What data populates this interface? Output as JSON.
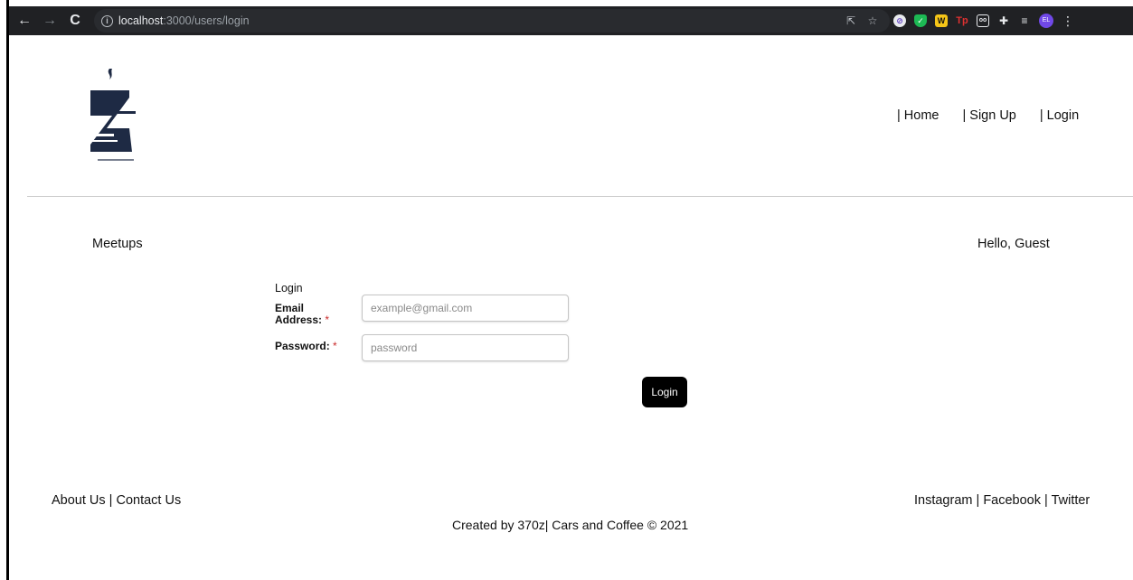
{
  "browser": {
    "url_host": "localhost",
    "url_path": ":3000/users/login",
    "avatar_initials": "EL",
    "icons": [
      "back-icon",
      "forward-icon",
      "reload-icon",
      "info-icon",
      "share-icon",
      "star-icon",
      "extension-icons",
      "puzzle-icon",
      "media-queue-icon",
      "menu-dots-icon"
    ]
  },
  "header": {
    "nav": {
      "home": "| Home",
      "signup": "| Sign Up",
      "login": "| Login"
    }
  },
  "main": {
    "meetups_link": "Meetups",
    "greeting": "Hello, Guest"
  },
  "form": {
    "heading": "Login",
    "email_label": "Email Address:",
    "email_placeholder": "example@gmail.com",
    "password_label": "Password:",
    "password_placeholder": "password",
    "required_mark": "*",
    "submit_label": "Login"
  },
  "footer": {
    "about": "About Us",
    "contact": "Contact Us",
    "separator": " | ",
    "instagram": "Instagram",
    "facebook": "Facebook",
    "twitter": "Twitter",
    "copyright": "Created by 370z| Cars and Coffee © 2021"
  },
  "colors": {
    "browser_bar": "#202124",
    "button": "#000000",
    "required": "#c92a2a",
    "logo": "#1e2a44"
  }
}
